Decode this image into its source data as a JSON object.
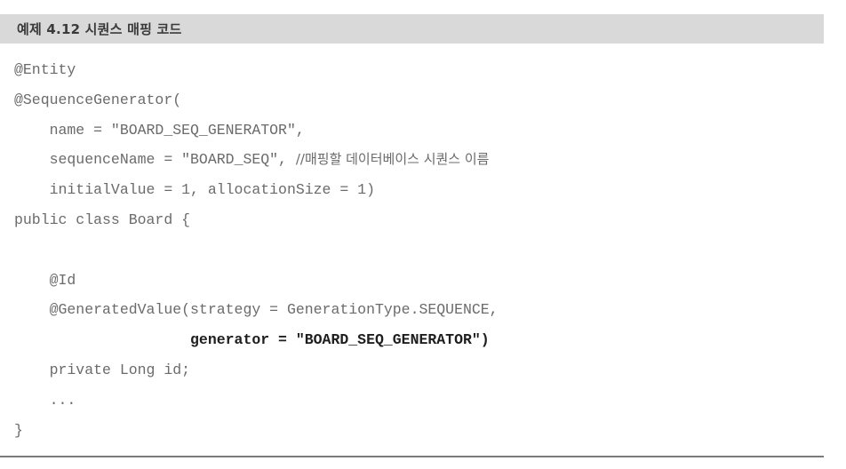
{
  "caption": "예제 4.12 시퀀스 매핑 코드",
  "code_lines": [
    {
      "code": "@Entity"
    },
    {
      "code": "@SequenceGenerator("
    },
    {
      "code": "    name = \"BOARD_SEQ_GENERATOR\","
    },
    {
      "code": "    sequenceName = \"BOARD_SEQ\", ",
      "comment": "//매핑할 데이터베이스 시퀀스 이름"
    },
    {
      "code": "    initialValue = 1, allocationSize = 1)"
    },
    {
      "code": "public class Board {"
    },
    {
      "code": ""
    },
    {
      "code": "    @Id"
    },
    {
      "code": "    @GeneratedValue(strategy = GenerationType.SEQUENCE,"
    },
    {
      "code": "                    generator = \"BOARD_SEQ_GENERATOR\")",
      "bold": true
    },
    {
      "code": "    private Long id;"
    },
    {
      "code": "    ..."
    },
    {
      "code": "}"
    }
  ]
}
